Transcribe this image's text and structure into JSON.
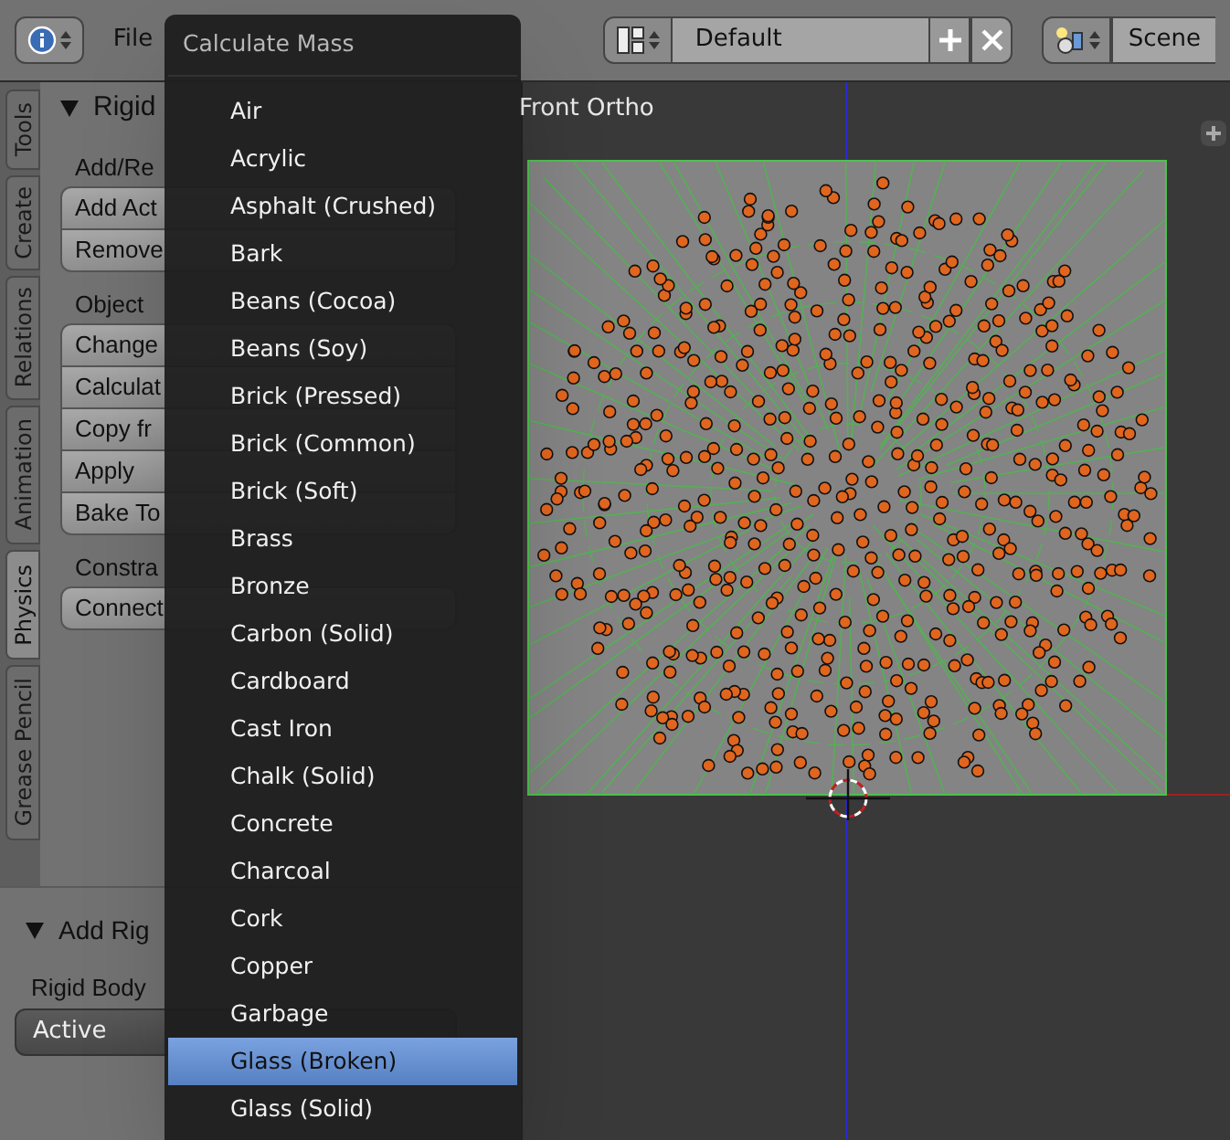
{
  "header": {
    "menus": [
      "File"
    ],
    "screen_layout": "Default",
    "scene": "Scene"
  },
  "tabs": [
    {
      "label": "Tools",
      "selected": false
    },
    {
      "label": "Create",
      "selected": false
    },
    {
      "label": "Relations",
      "selected": false
    },
    {
      "label": "Animation",
      "selected": false
    },
    {
      "label": "Physics",
      "selected": true
    },
    {
      "label": "Grease Pencil",
      "selected": false
    }
  ],
  "tool_panel": {
    "title": "Rigid",
    "sections": [
      {
        "label": "Add/Re",
        "buttons": [
          "Add Act",
          "Remove"
        ]
      },
      {
        "label": "Object",
        "buttons": [
          "Change",
          "Calculat",
          "Copy fr",
          "Apply",
          "Bake To"
        ]
      },
      {
        "label": "Constra",
        "buttons": [
          "Connect"
        ]
      }
    ]
  },
  "operator_panel": {
    "title": "Add Rig",
    "field_label": "Rigid Body",
    "field_value": "Active"
  },
  "viewport": {
    "label": "Front Ortho"
  },
  "menu": {
    "title": "Calculate Mass",
    "items": [
      {
        "label": "Air",
        "selected": false
      },
      {
        "label": "Acrylic",
        "selected": false
      },
      {
        "label": "Asphalt (Crushed)",
        "selected": false
      },
      {
        "label": "Bark",
        "selected": false
      },
      {
        "label": "Beans (Cocoa)",
        "selected": false
      },
      {
        "label": "Beans (Soy)",
        "selected": false
      },
      {
        "label": "Brick (Pressed)",
        "selected": false
      },
      {
        "label": "Brick (Common)",
        "selected": false
      },
      {
        "label": "Brick (Soft)",
        "selected": false
      },
      {
        "label": "Brass",
        "selected": false
      },
      {
        "label": "Bronze",
        "selected": false
      },
      {
        "label": "Carbon (Solid)",
        "selected": false
      },
      {
        "label": "Cardboard",
        "selected": false
      },
      {
        "label": "Cast Iron",
        "selected": false
      },
      {
        "label": "Chalk (Solid)",
        "selected": false
      },
      {
        "label": "Concrete",
        "selected": false
      },
      {
        "label": "Charcoal",
        "selected": false
      },
      {
        "label": "Cork",
        "selected": false
      },
      {
        "label": "Copper",
        "selected": false
      },
      {
        "label": "Garbage",
        "selected": false
      },
      {
        "label": "Glass (Broken)",
        "selected": true
      },
      {
        "label": "Glass (Solid)",
        "selected": false
      }
    ]
  }
}
